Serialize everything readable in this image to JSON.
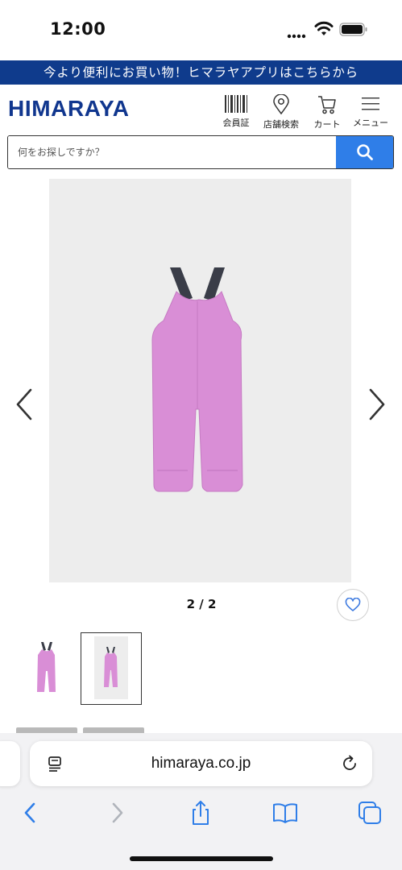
{
  "status_bar": {
    "time": "12:00"
  },
  "promo_banner": {
    "text": "今より便利にお買い物！ヒマラヤアプリはこちらから"
  },
  "header": {
    "logo": "HIMARAYA",
    "items": [
      {
        "label": "会員証",
        "icon": "barcode-icon"
      },
      {
        "label": "店舗検索",
        "icon": "location-pin-icon"
      },
      {
        "label": "カート",
        "icon": "cart-icon"
      },
      {
        "label": "メニュー",
        "icon": "menu-icon"
      }
    ]
  },
  "search": {
    "placeholder": "何をお探しですか？",
    "button_icon": "search-icon"
  },
  "gallery": {
    "pager": "2 / 2",
    "product_color": "#d98ed6",
    "strap_color": "#3a3d48"
  },
  "browser": {
    "url": "himaraya.co.jp"
  },
  "colors": {
    "brand": "#10368e",
    "banner": "#0f3b8c",
    "search_button": "#2f7ee8",
    "ios_blue": "#2f7ee8"
  }
}
